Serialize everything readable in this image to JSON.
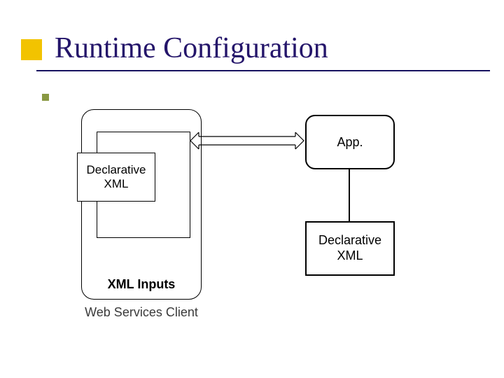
{
  "title": "Runtime Configuration",
  "diagram": {
    "outer_label": "XML Inputs",
    "web_services_label": "Web Services Client",
    "inner_decl_xml": "Declarative\nXML",
    "app_label": "App.",
    "right_decl_xml": "Declarative\nXML"
  }
}
